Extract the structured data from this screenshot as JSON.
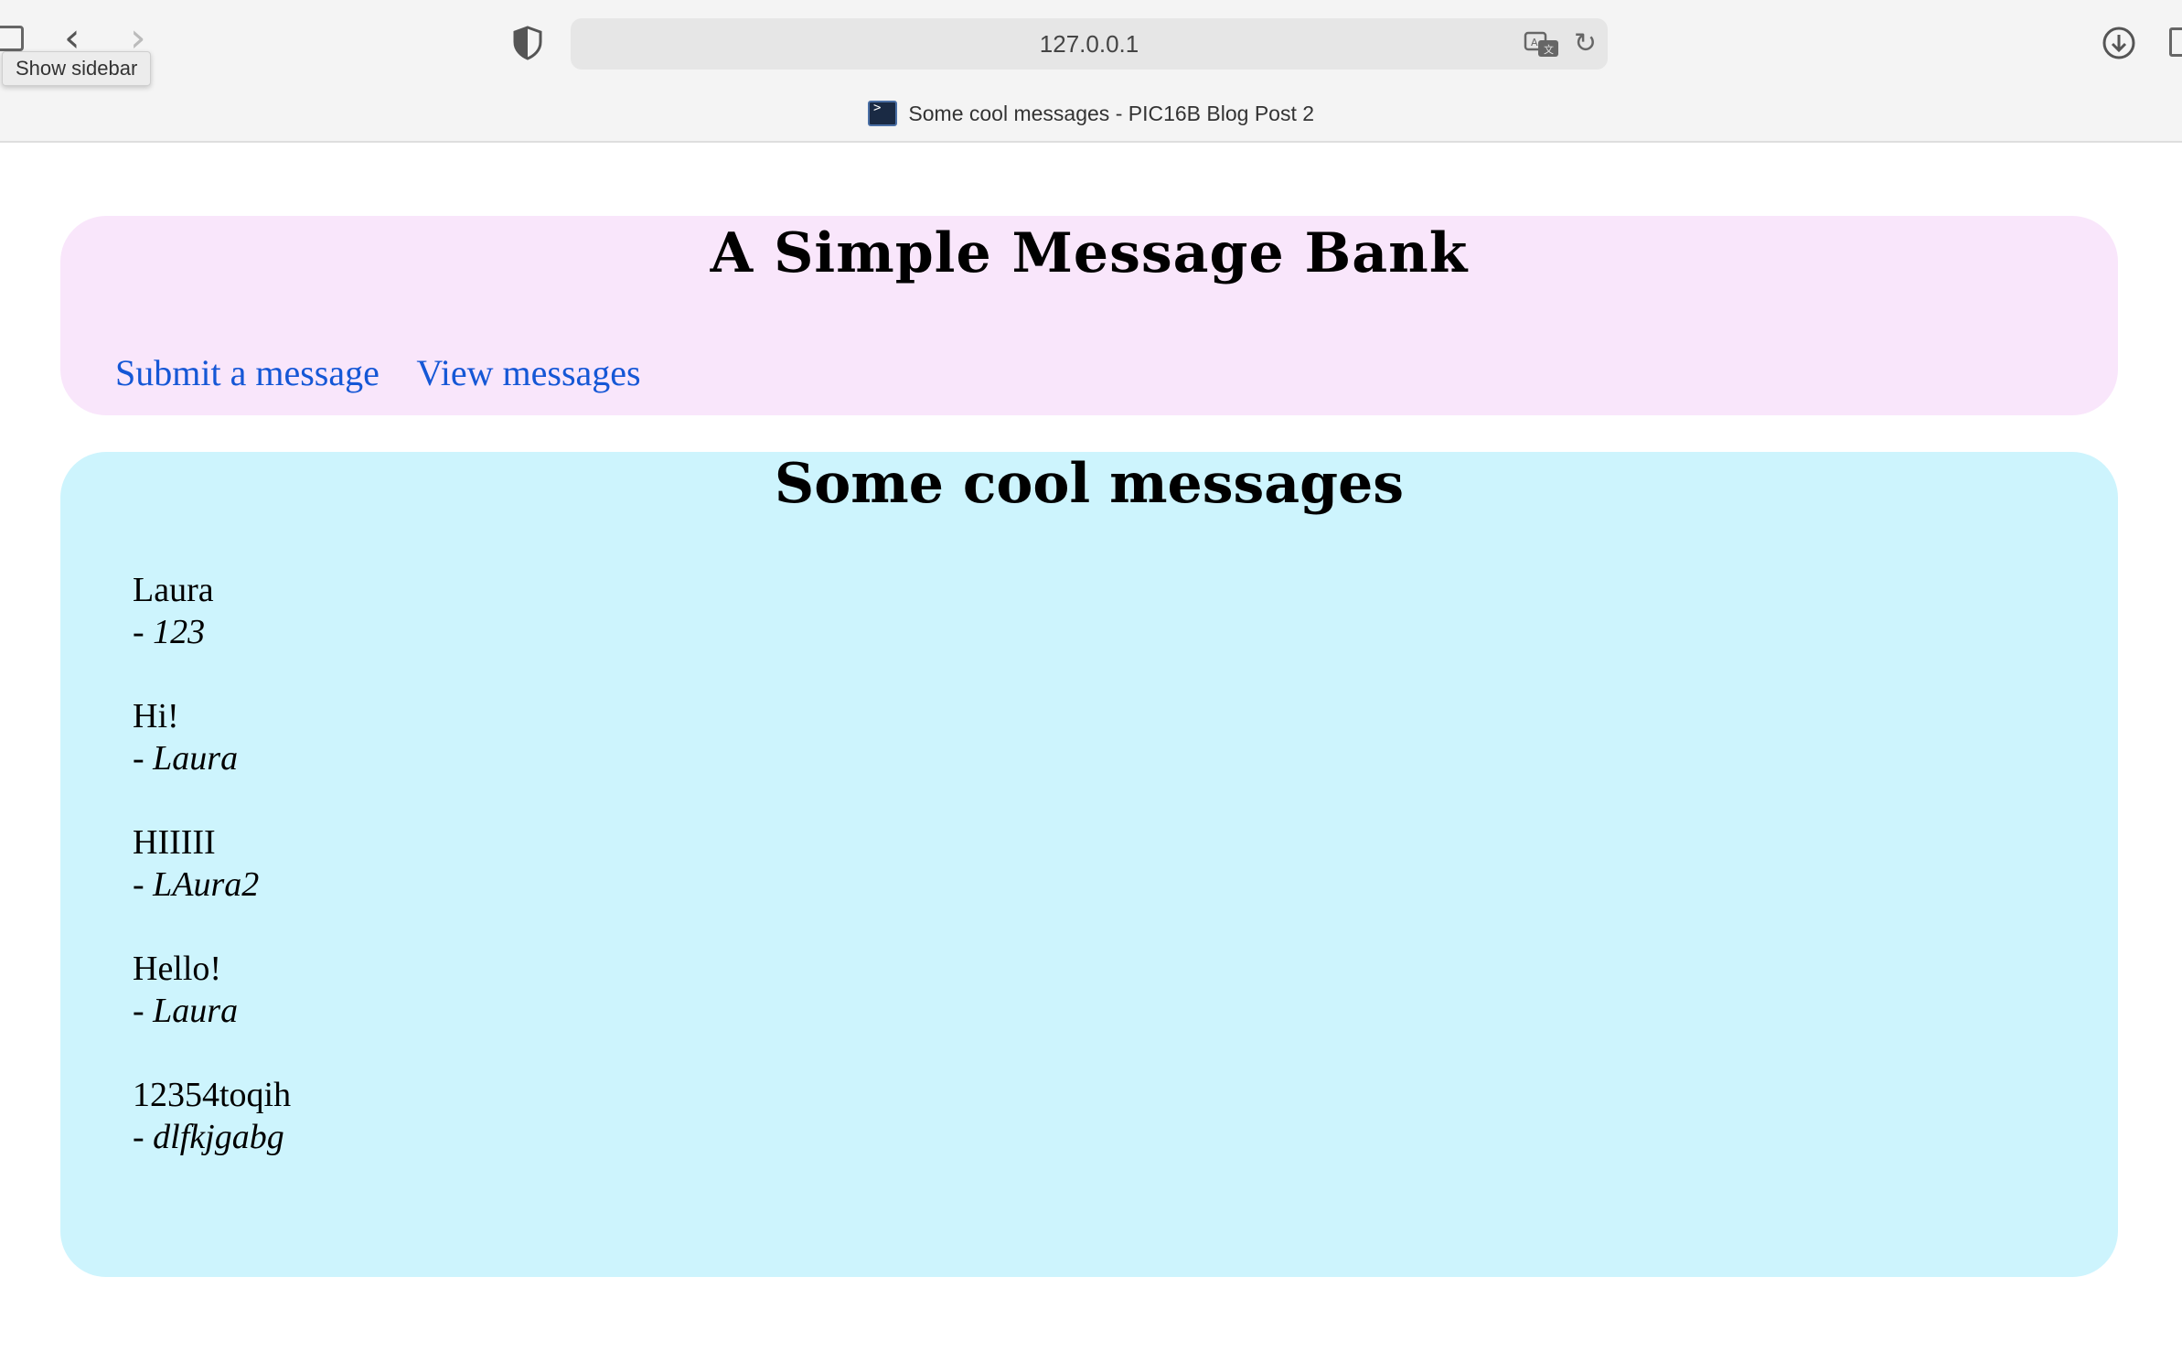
{
  "browser": {
    "tooltip": "Show sidebar",
    "url": "127.0.0.1",
    "tab_title": "Some cool messages - PIC16B Blog Post 2"
  },
  "header": {
    "title": "A Simple Message Bank",
    "nav": [
      {
        "label": "Submit a message"
      },
      {
        "label": "View messages"
      }
    ]
  },
  "main": {
    "title": "Some cool messages",
    "messages": [
      {
        "text": "Laura",
        "author": "- 123"
      },
      {
        "text": "Hi!",
        "author": "- Laura"
      },
      {
        "text": "HIIIII",
        "author": "- LAura2"
      },
      {
        "text": "Hello!",
        "author": "- Laura"
      },
      {
        "text": "12354toqih",
        "author": "- dlfkjgabg"
      }
    ]
  },
  "colors": {
    "header_bg": "#f9e6fb",
    "content_bg": "#cdf4fd",
    "link": "#1557d6"
  }
}
